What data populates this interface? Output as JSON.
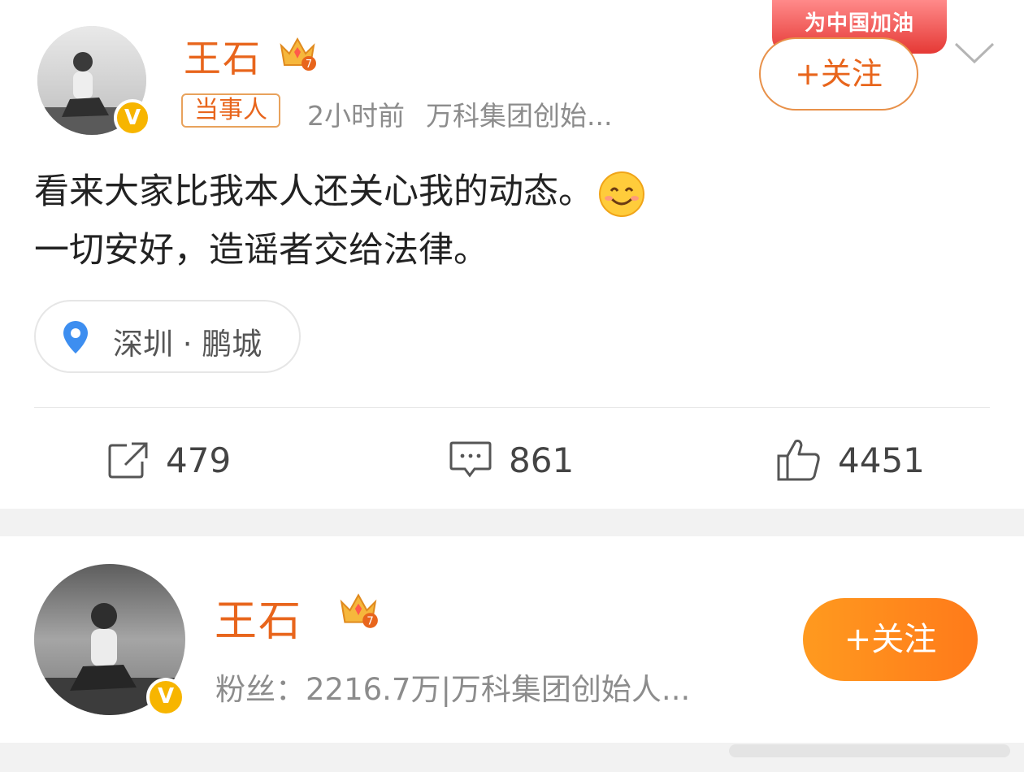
{
  "post": {
    "author_name": "王石",
    "tag": "当事人",
    "time": "2小时前",
    "source": "万科集团创始...",
    "follow_label": "+关注",
    "promo_banner": "为中国加油",
    "content_line1": "看来大家比我本人还关心我的动态。",
    "content_line2": "一切安好，造谣者交给法律。",
    "location": "深圳 · 鹏城",
    "actions": {
      "repost_count": "479",
      "comment_count": "861",
      "like_count": "4451"
    }
  },
  "profile_card": {
    "name": "王石",
    "fans_text": "粉丝：2216.7万|万科集团创始人...",
    "follow_label": "+关注"
  },
  "icons": {
    "crown": "crown-level-7-icon",
    "verified": "verified-v-icon",
    "location": "location-pin-icon",
    "repost": "repost-icon",
    "comment": "comment-icon",
    "like": "thumbs-up-icon",
    "chevron": "chevron-down-icon",
    "emoji": "smile-emoji-icon"
  },
  "colors": {
    "accent_orange": "#e8651c",
    "follow_gradient_start": "#ff9a1f",
    "verified_gold": "#f7b500",
    "pin_blue": "#3d8ef0",
    "promo_red": "#e53935"
  }
}
